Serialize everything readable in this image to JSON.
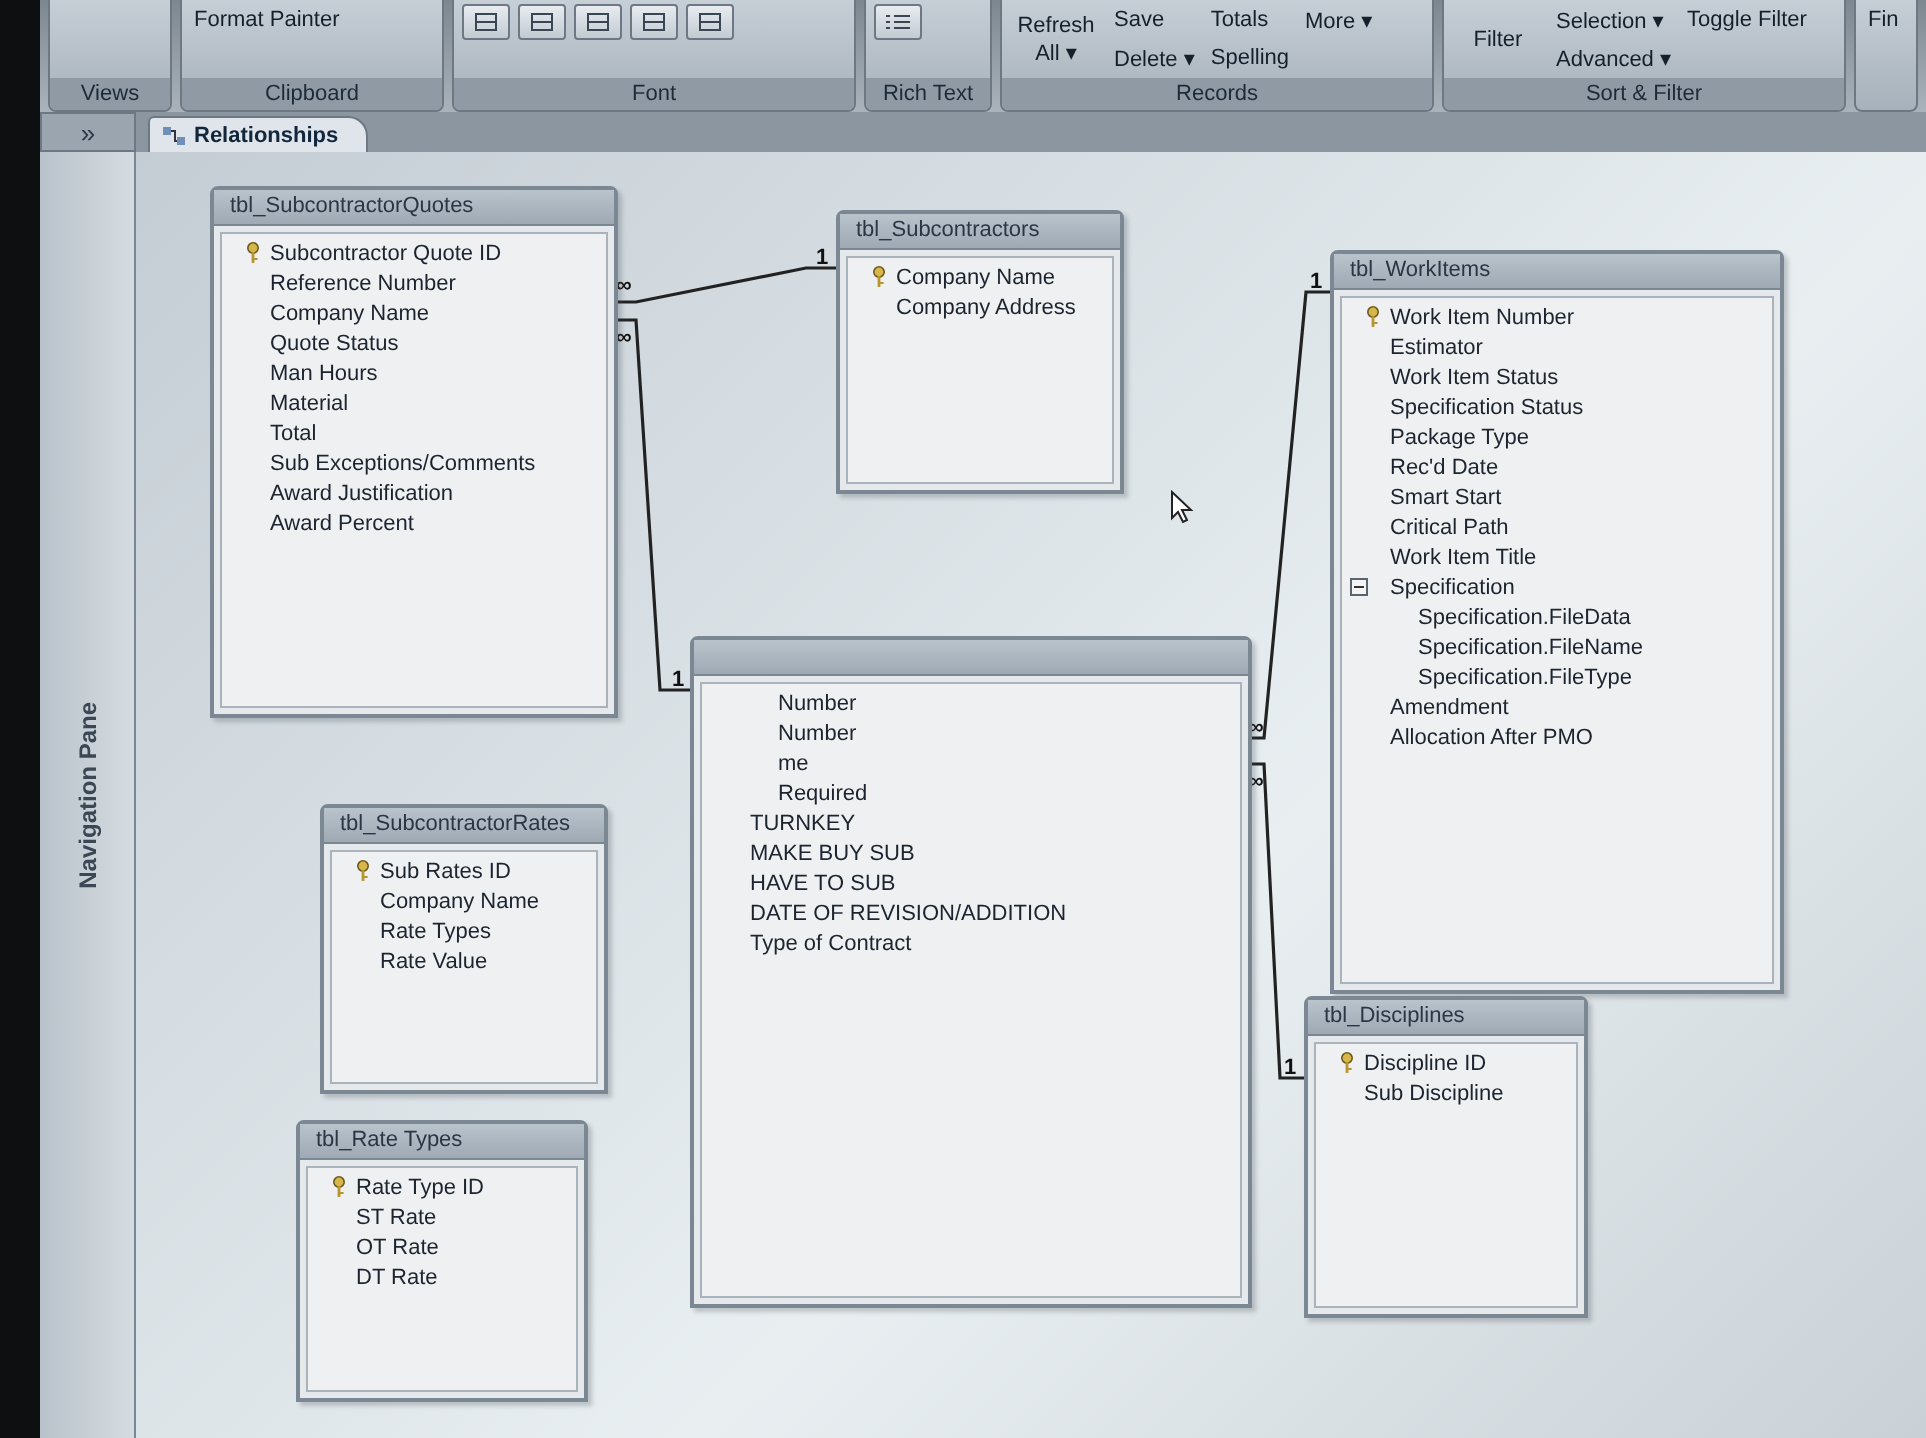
{
  "ribbon": {
    "groups": [
      {
        "label": "Views"
      },
      {
        "label": "Clipboard",
        "buttons": [
          "Format Painter"
        ]
      },
      {
        "label": "Font"
      },
      {
        "label": "Rich Text"
      },
      {
        "label": "Records",
        "buttons": [
          "Refresh All ▾",
          "Save",
          "Delete ▾",
          "Totals",
          "Spelling",
          "More ▾"
        ]
      },
      {
        "label": "Sort & Filter",
        "buttons": [
          "Filter",
          "Selection ▾",
          "Advanced ▾",
          "Toggle Filter"
        ]
      },
      {
        "buttons": [
          "Fin"
        ]
      }
    ]
  },
  "tabs": [
    {
      "label": "Relationships",
      "selected": true
    }
  ],
  "navigation_pane": {
    "toggle": "»",
    "label": "Navigation Pane"
  },
  "tables": [
    {
      "title": "tbl_SubcontractorQuotes",
      "fields": [
        {
          "name": "Subcontractor Quote ID",
          "key": true
        },
        {
          "name": "Reference Number",
          "key": false
        },
        {
          "name": "Company Name",
          "key": false
        },
        {
          "name": "Quote Status",
          "key": false
        },
        {
          "name": "Man Hours",
          "key": false
        },
        {
          "name": "Material",
          "key": false
        },
        {
          "name": "Total",
          "key": false
        },
        {
          "name": "Sub Exceptions/Comments",
          "key": false
        },
        {
          "name": "Award Justification",
          "key": false
        },
        {
          "name": "Award Percent",
          "key": false
        }
      ]
    },
    {
      "title": "tbl_Subcontractors",
      "fields": [
        {
          "name": "Company Name",
          "key": true
        },
        {
          "name": "Company Address",
          "key": false
        }
      ]
    },
    {
      "title": "tbl_WorkItems",
      "fields": [
        {
          "name": "Work Item Number",
          "key": true
        },
        {
          "name": "Estimator",
          "key": false
        },
        {
          "name": "Work Item Status",
          "key": false
        },
        {
          "name": "Specification Status",
          "key": false
        },
        {
          "name": "Package Type",
          "key": false
        },
        {
          "name": "Rec'd Date",
          "key": false
        },
        {
          "name": "Smart Start",
          "key": false
        },
        {
          "name": "Critical Path",
          "key": false
        },
        {
          "name": "Work Item Title",
          "key": false
        },
        {
          "name": "Specification",
          "key": false,
          "expanded": true,
          "children": [
            {
              "name": "Specification.FileData",
              "key": false
            },
            {
              "name": "Specification.FileName",
              "key": false
            },
            {
              "name": "Specification.FileType",
              "key": false
            }
          ]
        },
        {
          "name": "Amendment",
          "key": false
        },
        {
          "name": "Allocation After PMO",
          "key": false
        }
      ]
    },
    {
      "fields": [
        {
          "name": "Number",
          "key": false
        },
        {
          "name": "Number",
          "key": false
        },
        {
          "name": "me",
          "key": false
        },
        {
          "name": "Required",
          "key": false
        },
        {
          "name": "TURNKEY",
          "key": false
        },
        {
          "name": "MAKE BUY SUB",
          "key": false
        },
        {
          "name": "HAVE TO SUB",
          "key": false
        },
        {
          "name": "DATE OF REVISION/ADDITION",
          "key": false
        },
        {
          "name": "Type of Contract",
          "key": false
        }
      ]
    },
    {
      "title": "tbl_SubcontractorRates",
      "fields": [
        {
          "name": "Sub Rates ID",
          "key": true
        },
        {
          "name": "Company Name",
          "key": false
        },
        {
          "name": "Rate Types",
          "key": false
        },
        {
          "name": "Rate Value",
          "key": false
        }
      ]
    },
    {
      "title": "tbl_Rate Types",
      "fields": [
        {
          "name": "Rate Type ID",
          "key": true
        },
        {
          "name": "ST Rate",
          "key": false
        },
        {
          "name": "OT Rate",
          "key": false
        },
        {
          "name": "DT Rate",
          "key": false
        }
      ]
    },
    {
      "title": "tbl_Disciplines",
      "fields": [
        {
          "name": "Discipline ID",
          "key": true
        },
        {
          "name": "Sub Discipline",
          "key": false
        }
      ]
    }
  ],
  "relationships": [
    {
      "many_label": "∞",
      "one_label": "1"
    },
    {
      "many_label": "∞",
      "one_label": "1"
    },
    {
      "many_label": "∞",
      "one_label": "1"
    },
    {
      "many_label": "∞",
      "one_label": "1"
    }
  ]
}
